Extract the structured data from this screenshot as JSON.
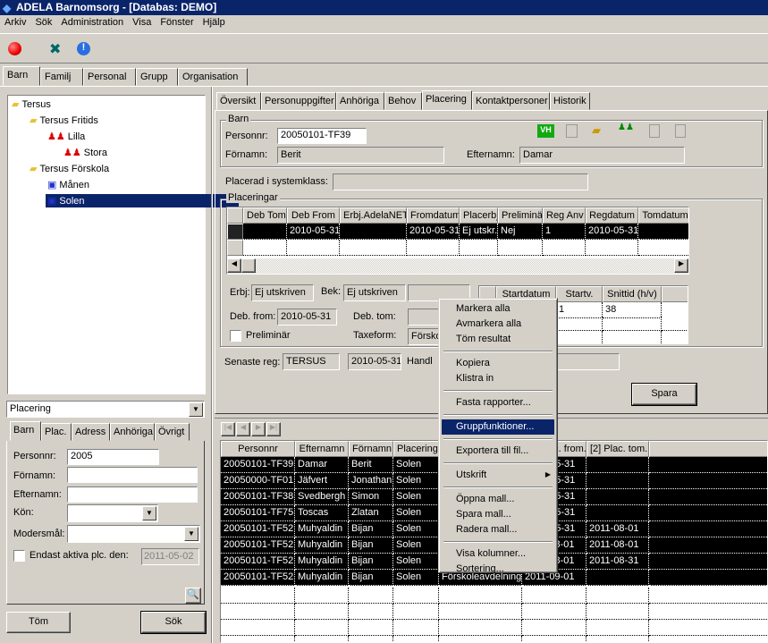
{
  "window": {
    "title": "ADELA Barnomsorg - [Databas: DEMO]"
  },
  "menubar": [
    "Arkiv",
    "Sök",
    "Administration",
    "Visa",
    "Fönster",
    "Hjälp"
  ],
  "toolbar": {
    "icons": [
      "stop-icon",
      "disconnect-icon",
      "info-icon"
    ]
  },
  "main_tabs": [
    "Barn",
    "Familj",
    "Personal",
    "Grupp",
    "Organisation"
  ],
  "tree": {
    "items": [
      "Tersus",
      "Tersus Fritids",
      "Lilla",
      "Stora",
      "Tersus Förskola",
      "Månen",
      "Solen"
    ],
    "selected": "Solen"
  },
  "search": {
    "type_select": "Placering",
    "tabs": [
      "Barn",
      "Plac.",
      "Adress",
      "Anhöriga",
      "Övrigt"
    ],
    "personnr_label": "Personnr:",
    "personnr": "2005",
    "fornamn_label": "Förnamn:",
    "efternamn_label": "Efternamn:",
    "kon_label": "Kön:",
    "modersmal_label": "Modersmål:",
    "active_label": "Endast aktiva plc. den:",
    "active_date": "2011-05-02",
    "clear": "Töm",
    "search": "Sök"
  },
  "detail_tabs": [
    "Översikt",
    "Personuppgifter",
    "Anhöriga",
    "Behov",
    "Placering",
    "Kontaktpersoner",
    "Historik"
  ],
  "barn": {
    "group": "Barn",
    "personnr_label": "Personnr:",
    "personnr": "20050101-TF39",
    "fornamn_label": "Förnamn:",
    "fornamn": "Berit",
    "efternamn_label": "Efternamn:",
    "efternamn": "Damar",
    "vh": "VH"
  },
  "systemklass_label": "Placerad i systemklass:",
  "placeringar": {
    "group": "Placeringar",
    "columns": [
      "Deb Tom",
      "Deb From",
      "Erbj.AdelaNET",
      "Fromdatum",
      "Placerbj",
      "Preliminär",
      "Reg Anv",
      "Regdatum",
      "Tomdatum"
    ],
    "rows": [
      [
        "",
        "2010-05-31",
        "",
        "2010-05-31",
        "Ej utskr.",
        "Nej",
        "1",
        "2010-05-31",
        ""
      ]
    ]
  },
  "details": {
    "erbj_label": "Erbj:",
    "erbj": "Ej utskriven",
    "bek_label": "Bek:",
    "bek": "Ej utskriven",
    "deb_from_label": "Deb. from:",
    "deb_from": "2010-05-31",
    "deb_tom_label": "Deb. tom:",
    "prelim_label": "Preliminär",
    "taxeform_label": "Taxeform:",
    "taxeform": "Försko",
    "sched_columns": [
      "Startdatum",
      "Startv.",
      "Snittid (h/v)"
    ],
    "sched_rows": [
      [
        "",
        "1",
        "38"
      ]
    ]
  },
  "senaste": {
    "label": "Senaste reg:",
    "user": "TERSUS",
    "date": "2010-05-31",
    "handl_label": "Handl"
  },
  "save": "Spara",
  "results": {
    "columns": [
      "Personnr",
      "Efternamn",
      "Förnamn",
      "Placering",
      "",
      "[2] Plac. from.",
      "[2] Plac. tom."
    ],
    "rows": [
      [
        "20050101-TF39",
        "Damar",
        "Berit",
        "Solen",
        "",
        "2010-05-31",
        ""
      ],
      [
        "20050000-TF01",
        "Jäfvert",
        "Jonathan",
        "Solen",
        "",
        "2010-05-31",
        ""
      ],
      [
        "20050101-TF38",
        "Svedbergh",
        "Simon",
        "Solen",
        "",
        "2010-05-31",
        ""
      ],
      [
        "20050101-TF75",
        "Toscas",
        "Zlatan",
        "Solen",
        "",
        "2010-05-31",
        ""
      ],
      [
        "20050101-TF52",
        "Muhyaldin",
        "Bijan",
        "Solen",
        "",
        "2010-05-31",
        "2011-08-01"
      ],
      [
        "20050101-TF52",
        "Muhyaldin",
        "Bijan",
        "Solen",
        "",
        "2011-08-01",
        "2011-08-01"
      ],
      [
        "20050101-TF52",
        "Muhyaldin",
        "Bijan",
        "Solen",
        "",
        "2011-08-01",
        "2011-08-31"
      ],
      [
        "20050101-TF52",
        "Muhyaldin",
        "Bijan",
        "Solen",
        "Förskoleavdelning",
        "2011-09-01",
        ""
      ]
    ]
  },
  "context_menu": {
    "items": [
      "Markera alla",
      "Avmarkera alla",
      "Töm resultat",
      "-",
      "Kopiera",
      "Klistra in",
      "-",
      "Fasta rapporter...",
      "-",
      "Gruppfunktioner...",
      "-",
      "Exportera till fil...",
      "-",
      "Utskrift",
      "-",
      "Öppna mall...",
      "Spara mall...",
      "Radera mall...",
      "-",
      "Visa kolumner...",
      "Sortering..."
    ],
    "highlighted": "Gruppfunktioner...",
    "submenu": "Utskrift"
  },
  "colors": {
    "titlebar": "#0a246a",
    "selection": "#0a246a",
    "face": "#d4d0c8"
  }
}
